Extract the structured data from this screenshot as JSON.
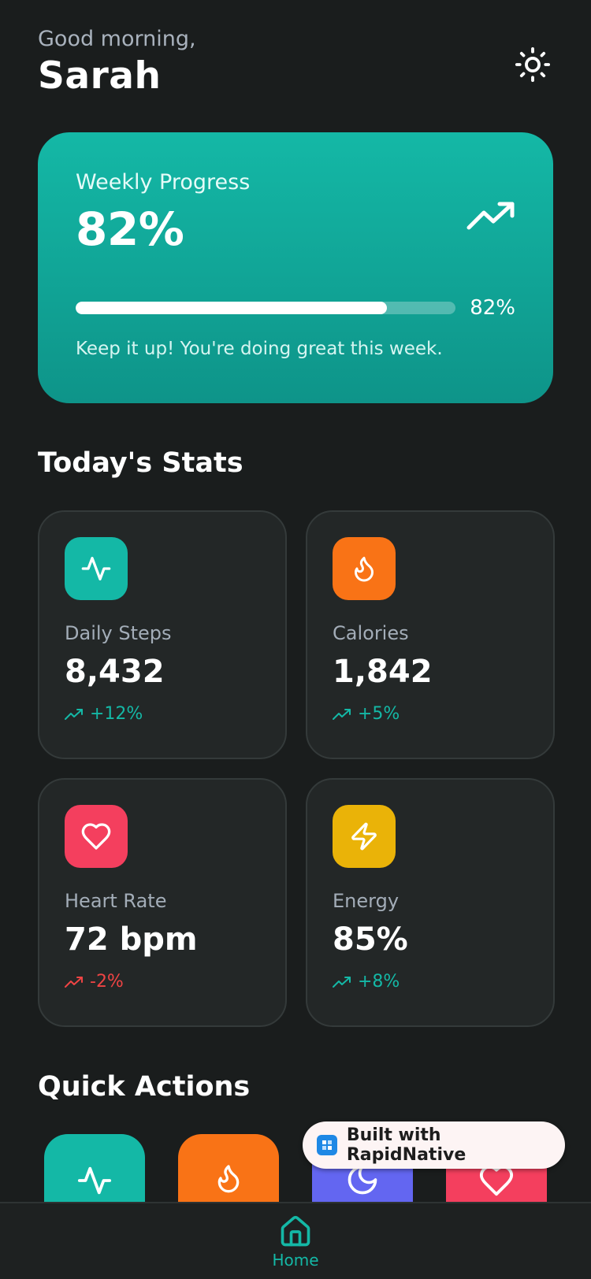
{
  "header": {
    "greeting": "Good morning,",
    "name": "Sarah",
    "theme_icon": "sun-icon"
  },
  "progress": {
    "title": "Weekly Progress",
    "value": "82%",
    "percent_label": "82%",
    "fraction": 0.82,
    "message": "Keep it up! You're doing great this week.",
    "icon": "trending-up-icon"
  },
  "stats_section": {
    "title": "Today's Stats"
  },
  "stats": [
    {
      "label": "Daily Steps",
      "value": "8,432",
      "change": "+12%",
      "icon": "activity-icon",
      "color": "#14b8a6",
      "change_color": "#14b8a6"
    },
    {
      "label": "Calories",
      "value": "1,842",
      "change": "+5%",
      "icon": "flame-icon",
      "color": "#f97316",
      "change_color": "#14b8a6"
    },
    {
      "label": "Heart Rate",
      "value": "72 bpm",
      "change": "-2%",
      "icon": "heart-icon",
      "color": "#f43f5e",
      "change_color": "#ef4444"
    },
    {
      "label": "Energy",
      "value": "85%",
      "change": "+8%",
      "icon": "zap-icon",
      "color": "#eab308",
      "change_color": "#14b8a6"
    }
  ],
  "quick_actions": {
    "title": "Quick Actions",
    "items": [
      {
        "icon": "activity-icon",
        "color": "#14b8a6"
      },
      {
        "icon": "flame-icon",
        "color": "#f97316"
      },
      {
        "icon": "moon-icon",
        "color": "#6366f1"
      },
      {
        "icon": "heart-icon",
        "color": "#f43f5e"
      }
    ]
  },
  "badge": {
    "text": "Built with RapidNative"
  },
  "tabbar": {
    "home_label": "Home",
    "accent": "#14b8a6"
  }
}
